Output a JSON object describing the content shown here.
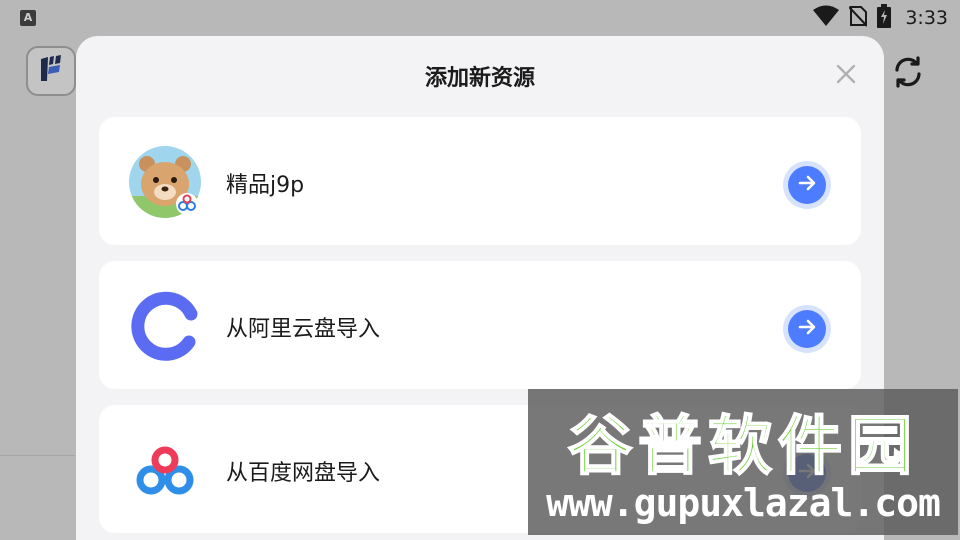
{
  "status_bar": {
    "left_badge": "A",
    "time": "3:33",
    "icons": [
      "wifi-icon",
      "no-sim-icon",
      "battery-charging-icon"
    ]
  },
  "background_app": {
    "logo_icon": "app-logo-icon",
    "refresh_icon": "refresh-icon"
  },
  "modal": {
    "title": "添加新资源",
    "close_icon": "close-icon",
    "options": [
      {
        "label": "精品j9p",
        "icon": "bear-avatar-icon",
        "action_icon": "arrow-right-icon"
      },
      {
        "label": "从阿里云盘导入",
        "icon": "aliyun-drive-icon",
        "action_icon": "arrow-right-icon"
      },
      {
        "label": "从百度网盘导入",
        "icon": "baidu-netdisk-icon",
        "action_icon": "arrow-right-icon"
      }
    ]
  },
  "watermark": {
    "title": "谷普软件园",
    "url": "www.gupuxlazal.com"
  },
  "colors": {
    "accent": "#4d7cfe",
    "accent_ring": "#d7e3fd",
    "modal_bg": "#f3f3f6",
    "aliyun_blue": "#5b6cf2",
    "watermark_green": "#6fcf38"
  }
}
